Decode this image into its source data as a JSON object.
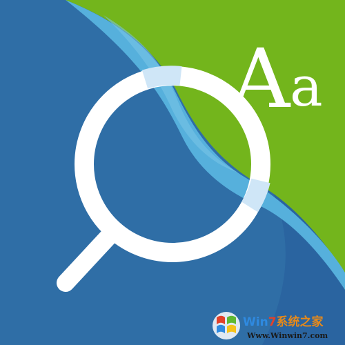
{
  "icon": {
    "glyph_upper": "A",
    "glyph_lower": "a",
    "magnifier_icon_name": "magnifier-icon"
  },
  "watermark": {
    "title_part1": "Win",
    "title_part2": "7",
    "title_part3": "系统之家",
    "url": "Www.Winwin7.com"
  },
  "colors": {
    "background_blue": "#2f6ea6",
    "inner_blue": "#2a64a0",
    "page_curl_light_blue": "#56b0dc",
    "page_curl_green": "#73b51c",
    "page_curl_dark_green": "#5b9517",
    "magnifier_ring": "#ffffff",
    "magnifier_highlight": "#cfe6f7"
  }
}
